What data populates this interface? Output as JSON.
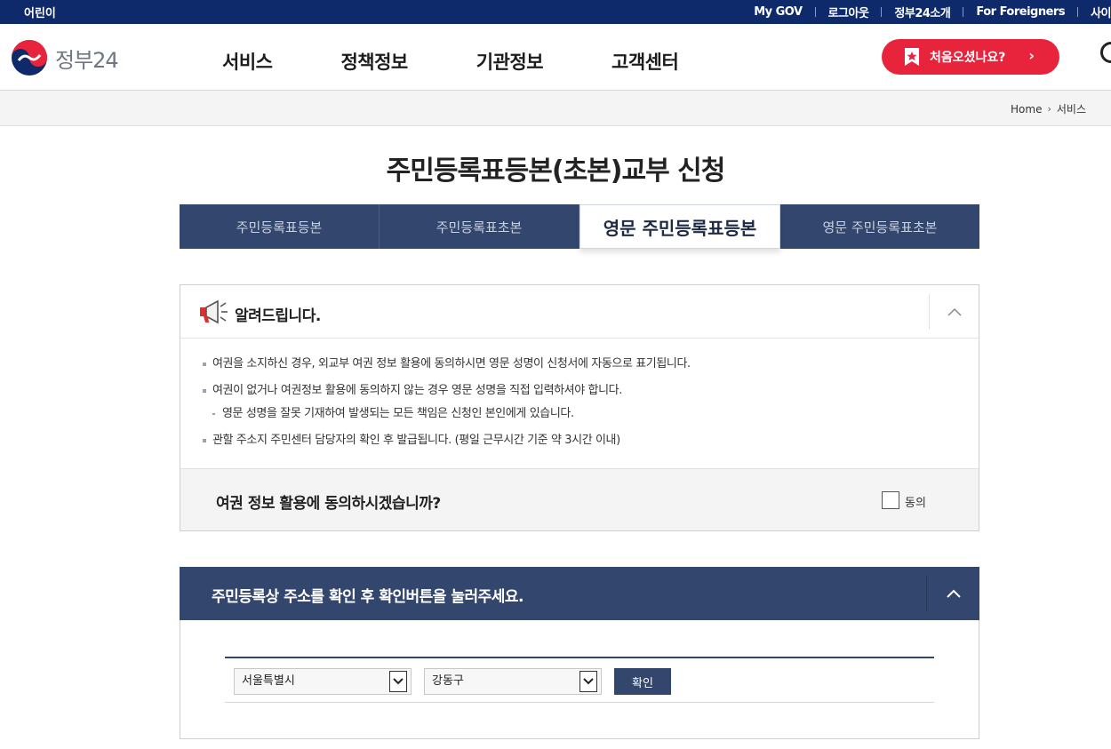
{
  "topbar": {
    "kids_link": "어린이",
    "utility_links": [
      "My GOV",
      "로그아웃",
      "정부24소개",
      "For Foreigners",
      "사이"
    ]
  },
  "header": {
    "logo_text": "정부24",
    "nav": [
      "서비스",
      "정책정보",
      "기관정보",
      "고객센터"
    ],
    "first_visit_label": "처음오셨나요?",
    "first_visit_icon": "bookmark-star-icon"
  },
  "breadcrumb": {
    "items": [
      "Home",
      "서비스"
    ]
  },
  "page": {
    "title": "주민등록표등본(초본)교부 신청"
  },
  "tabs": [
    {
      "label": "주민등록표등본",
      "active": false
    },
    {
      "label": "주민등록표초본",
      "active": false
    },
    {
      "label": "영문 주민등록표등본",
      "active": true
    },
    {
      "label": "영문 주민등록표초본",
      "active": false
    }
  ],
  "notice": {
    "title": "알려드립니다.",
    "icon": "megaphone-icon",
    "items": [
      "여권을 소지하신 경우, 외교부 여권 정보 활용에 동의하시면 영문 성명이 신청서에 자동으로 표기됩니다.",
      "여권이 없거나 여권정보 활용에 동의하지 않는 경우 영문 성명을 직접 입력하셔야 합니다."
    ],
    "sub_item": "영문 성명을 잘못 기재하여 발생되는 모든 책임은 신청인 본인에게 있습니다.",
    "last_item": "관할 주소지 주민센터 담당자의 확인 후 발급됩니다. (평일 근무시간 기준 약 3시간 이내)",
    "consent_question": "여권 정보 활용에 동의하시겠습니까?",
    "consent_label": "동의",
    "consent_checked": false
  },
  "address": {
    "title": "주민등록상 주소를 확인 후 확인버튼을 눌러주세요.",
    "city_selected": "서울특별시",
    "district_selected": "강동구",
    "confirm_label": "확인"
  },
  "colors": {
    "topbar": "#0f2a6b",
    "navy": "#33466e",
    "accent_red": "#e8243c"
  }
}
